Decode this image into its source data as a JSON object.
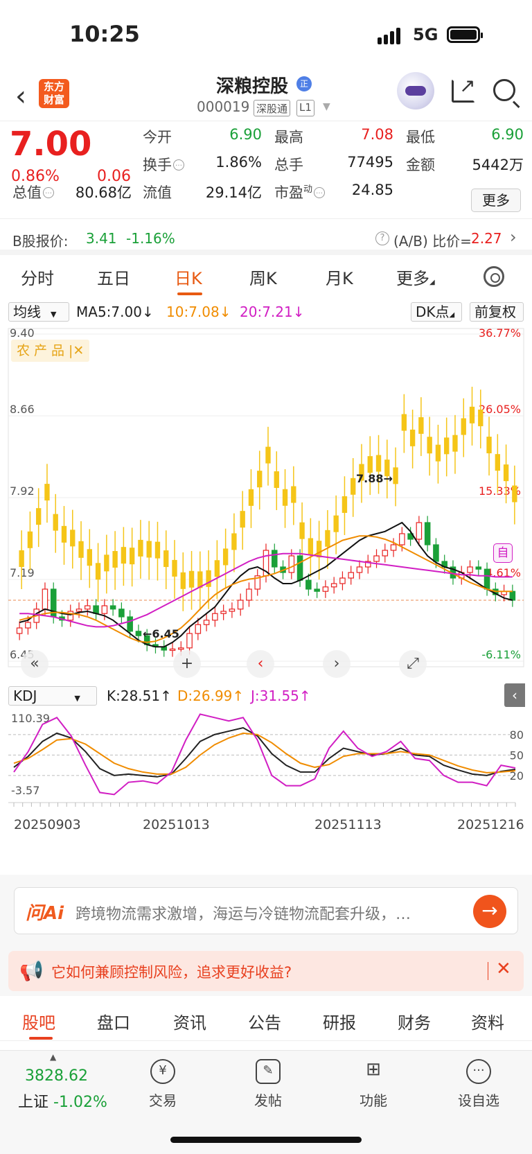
{
  "status_bar": {
    "time": "10:25",
    "network": "5G"
  },
  "header": {
    "app_logo": "东方财富",
    "stock_name": "深粮控股",
    "cert_badge": "正",
    "stock_code": "000019",
    "tag_connect": "深股通",
    "tag_level": "L1"
  },
  "quote": {
    "price": "7.00",
    "change_pct": "0.86%",
    "change_amt": "0.06",
    "open_label": "今开",
    "open": "6.90",
    "high_label": "最高",
    "high": "7.08",
    "low_label": "最低",
    "low": "6.90",
    "turnover_label": "换手",
    "turnover": "1.86%",
    "volume_label": "总手",
    "volume": "77495",
    "amount_label": "金额",
    "amount": "5442万",
    "mktcap_label": "总值",
    "mktcap": "80.68亿",
    "float_label": "流值",
    "float_cap": "29.14亿",
    "pe_label": "市盈",
    "pe_sup": "动",
    "pe": "24.85",
    "more_label": "更多"
  },
  "b_share": {
    "label": "B股报价:",
    "price": "3.41",
    "pct": "-1.16%",
    "ratio_label": "(A/B) 比价=",
    "ratio": "2.27"
  },
  "period_tabs": [
    "分时",
    "五日",
    "日K",
    "周K",
    "月K",
    "更多"
  ],
  "active_period": "日K",
  "chart_toolbar": {
    "indicator": "均线",
    "ma5": "MA5:7.00",
    "ma10": "10:7.08",
    "ma20": "20:7.21",
    "dk_label": "DK点",
    "adjust_label": "前复权",
    "sector_tag": "农产品",
    "kdj_select": "KDJ",
    "k_val": "K:28.51",
    "d_val": "D:26.99",
    "j_val": "J:31.55",
    "auto_badge": "自"
  },
  "chart_data": [
    {
      "type": "candlestick",
      "ylim": [
        6.45,
        9.4
      ],
      "y_ticks": [
        "9.40",
        "8.66",
        "7.92",
        "7.19",
        "6.45"
      ],
      "pct_ticks": [
        "36.77%",
        "26.05%",
        "15.33%",
        "4.61%",
        "-6.11%"
      ],
      "annotations": {
        "high_mark": "7.88",
        "low_mark": "6.45"
      },
      "x_tick_labels": [
        "20250903",
        "20251013",
        "20251113",
        "20251216"
      ],
      "ohlc_close_approx": [
        6.75,
        6.8,
        6.92,
        7.1,
        6.85,
        6.82,
        6.9,
        6.92,
        6.95,
        6.88,
        6.95,
        6.92,
        6.85,
        6.72,
        6.68,
        6.6,
        6.58,
        6.55,
        6.56,
        6.57,
        6.7,
        6.78,
        6.82,
        6.88,
        6.9,
        6.92,
        7.0,
        7.1,
        7.22,
        7.45,
        7.3,
        7.25,
        7.4,
        7.18,
        7.1,
        7.08,
        7.12,
        7.15,
        7.2,
        7.25,
        7.3,
        7.35,
        7.4,
        7.45,
        7.5,
        7.6,
        7.55,
        7.7,
        7.5,
        7.35,
        7.3,
        7.2,
        7.25,
        7.3,
        7.28,
        7.1,
        7.05,
        7.08,
        7.0
      ],
      "ma5": [
        6.8,
        6.82,
        6.88,
        6.92,
        6.9,
        6.88,
        6.87,
        6.89,
        6.9,
        6.88,
        6.86,
        6.82,
        6.76,
        6.7,
        6.64,
        6.6,
        6.58,
        6.58,
        6.62,
        6.68,
        6.76,
        6.82,
        6.88,
        6.94,
        7.04,
        7.14,
        7.22,
        7.28,
        7.3,
        7.26,
        7.2,
        7.15,
        7.15,
        7.18,
        7.22,
        7.26,
        7.3,
        7.36,
        7.42,
        7.48,
        7.54,
        7.58,
        7.6,
        7.62,
        7.66,
        7.7,
        7.62,
        7.5,
        7.4,
        7.34,
        7.3,
        7.28,
        7.25,
        7.2,
        7.15,
        7.1,
        7.06,
        7.02,
        7.0
      ],
      "ma10": [
        6.82,
        6.84,
        6.86,
        6.88,
        6.89,
        6.89,
        6.88,
        6.87,
        6.85,
        6.82,
        6.78,
        6.74,
        6.7,
        6.66,
        6.63,
        6.62,
        6.63,
        6.66,
        6.7,
        6.75,
        6.82,
        6.9,
        6.98,
        7.05,
        7.1,
        7.14,
        7.17,
        7.19,
        7.2,
        7.22,
        7.24,
        7.27,
        7.3,
        7.34,
        7.38,
        7.42,
        7.46,
        7.5,
        7.54,
        7.56,
        7.58,
        7.58,
        7.57,
        7.55,
        7.52,
        7.48,
        7.44,
        7.4,
        7.36,
        7.32,
        7.28,
        7.24,
        7.2,
        7.16,
        7.13,
        7.1,
        7.08,
        7.08,
        7.08
      ],
      "ma20": [
        6.88,
        6.88,
        6.87,
        6.86,
        6.85,
        6.83,
        6.81,
        6.79,
        6.77,
        6.76,
        6.76,
        6.77,
        6.79,
        6.81,
        6.84,
        6.87,
        6.91,
        6.95,
        6.99,
        7.03,
        7.07,
        7.11,
        7.15,
        7.19,
        7.23,
        7.27,
        7.31,
        7.35,
        7.38,
        7.4,
        7.41,
        7.42,
        7.42,
        7.42,
        7.41,
        7.4,
        7.39,
        7.38,
        7.37,
        7.36,
        7.35,
        7.34,
        7.33,
        7.32,
        7.31,
        7.3,
        7.29,
        7.28,
        7.27,
        7.26,
        7.25,
        7.24,
        7.23,
        7.23,
        7.22,
        7.22,
        7.21,
        7.21,
        7.21
      ]
    },
    {
      "type": "line",
      "name": "KDJ",
      "ylim": [
        -3.57,
        110.39
      ],
      "y_ticks": [
        "110.39",
        "-3.57"
      ],
      "ref_lines": [
        "80",
        "50",
        "20"
      ],
      "series": [
        {
          "name": "K",
          "values": [
            32,
            48,
            70,
            82,
            75,
            55,
            30,
            20,
            22,
            20,
            18,
            22,
            45,
            70,
            80,
            85,
            90,
            78,
            52,
            35,
            25,
            25,
            45,
            60,
            55,
            50,
            52,
            60,
            50,
            48,
            35,
            28,
            22,
            20,
            26,
            29
          ]
        },
        {
          "name": "D",
          "values": [
            38,
            45,
            58,
            72,
            74,
            66,
            52,
            38,
            30,
            25,
            22,
            22,
            32,
            50,
            65,
            75,
            82,
            80,
            68,
            52,
            38,
            32,
            36,
            48,
            52,
            52,
            52,
            55,
            52,
            50,
            42,
            34,
            28,
            24,
            25,
            27
          ]
        },
        {
          "name": "J",
          "values": [
            25,
            55,
            95,
            105,
            78,
            35,
            -5,
            -8,
            10,
            12,
            8,
            25,
            72,
            110,
            105,
            100,
            105,
            72,
            20,
            5,
            5,
            15,
            60,
            85,
            60,
            48,
            55,
            70,
            45,
            42,
            20,
            10,
            10,
            5,
            35,
            31
          ]
        }
      ]
    }
  ],
  "ai_bar": {
    "logo": "问Ai",
    "text": "跨境物流需求激增，海运与冷链物流配套升级，…"
  },
  "promo": {
    "text": "它如何兼顾控制风险，追求更好收益?"
  },
  "content_tabs": [
    "股吧",
    "盘口",
    "资讯",
    "公告",
    "研报",
    "财务",
    "资料"
  ],
  "bottom_nav": {
    "index_value": "3828.62",
    "index_label": "上证",
    "index_pct": "-1.02%",
    "items": [
      "交易",
      "发帖",
      "功能",
      "设自选"
    ]
  },
  "colors": {
    "up": "#e8201f",
    "down": "#1aa038",
    "accent": "#e85a12",
    "candle_gold": "#f5c518",
    "ma5": "#111111",
    "ma10": "#f08c00",
    "ma20": "#d11ec3"
  }
}
